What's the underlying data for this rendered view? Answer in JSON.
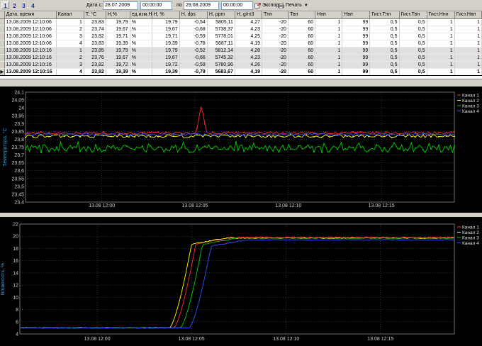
{
  "toolbar": {
    "pages": [
      "1",
      "2",
      "3",
      "4"
    ],
    "active_page": 0,
    "date_from_label": "Дата с:",
    "date_from": "28.07.2009",
    "time_from": "00:00:00",
    "date_to_label": "по",
    "date_to": "29.08.2009",
    "time_to": "00:00:00",
    "export_label": "Экспорт",
    "print_label": "Печать"
  },
  "table": {
    "columns": [
      "Дата, время",
      "Канал",
      "T, °C",
      "H,%",
      "ед.изм.H",
      "H, %",
      "H, dps",
      "H, ppm",
      "H, g/m3",
      "Тнп",
      "Твп",
      "Ннп",
      "Нвп",
      "Гист.Тнп",
      "Гист.Твп",
      "Гист.Ннп",
      "Гист.Нвп"
    ],
    "rows": [
      [
        "13.08.2009 12:10:06",
        "1",
        "23,83",
        "19,79",
        "%",
        "19,79",
        "-0,54",
        "5805,11",
        "4,27",
        "-20",
        "60",
        "1",
        "99",
        "0,5",
        "0,5",
        "1",
        "1"
      ],
      [
        "13.08.2009 12:10:06",
        "2",
        "23,74",
        "19,67",
        "%",
        "19,67",
        "-0,68",
        "5738,37",
        "4,23",
        "-20",
        "60",
        "1",
        "99",
        "0,5",
        "0,5",
        "1",
        "1"
      ],
      [
        "13.08.2009 12:10:06",
        "3",
        "23,82",
        "19,71",
        "%",
        "19,71",
        "-0,59",
        "5778,01",
        "4,25",
        "-20",
        "60",
        "1",
        "99",
        "0,5",
        "0,5",
        "1",
        "1"
      ],
      [
        "13.08.2009 12:10:06",
        "4",
        "23,83",
        "19,39",
        "%",
        "19,39",
        "-0,78",
        "5687,11",
        "4,19",
        "-20",
        "60",
        "1",
        "99",
        "0,5",
        "0,5",
        "1",
        "1"
      ],
      [
        "13.08.2009 12:10:16",
        "1",
        "23,85",
        "19,79",
        "%",
        "19,79",
        "-0,52",
        "5812,14",
        "4,28",
        "-20",
        "60",
        "1",
        "99",
        "0,5",
        "0,5",
        "1",
        "1"
      ],
      [
        "13.08.2009 12:10:16",
        "2",
        "23,76",
        "19,67",
        "%",
        "19,67",
        "-0,66",
        "5745,32",
        "4,23",
        "-20",
        "60",
        "1",
        "99",
        "0,5",
        "0,5",
        "1",
        "1"
      ],
      [
        "13.08.2009 12:10:16",
        "3",
        "23,82",
        "19,72",
        "%",
        "19,72",
        "-0,59",
        "5780,96",
        "4,26",
        "-20",
        "60",
        "1",
        "99",
        "0,5",
        "0,5",
        "1",
        "1"
      ],
      [
        "13.08.2009 12:10:16",
        "4",
        "23,82",
        "19,39",
        "%",
        "19,39",
        "-0,79",
        "5683,67",
        "4,19",
        "-20",
        "60",
        "1",
        "99",
        "0,5",
        "0,5",
        "1",
        "1"
      ]
    ]
  },
  "chart_data": [
    {
      "type": "line",
      "title": "",
      "ylabel": "Температура, °С",
      "xlabel": "",
      "ylim": [
        23.4,
        24.1
      ],
      "yticks": [
        "24,1",
        "24,05",
        "24",
        "23,95",
        "23,9",
        "23,85",
        "23,8",
        "23,75",
        "23,7",
        "23,65",
        "23,6",
        "23,55",
        "23,5",
        "23,45",
        "23,4"
      ],
      "x_ticks": [
        "13.08 12:00",
        "13.08 12:05",
        "13.08 12:10",
        "13.08 12:15"
      ],
      "x_range": [
        "13.08 11:56:00",
        "13.08 12:18:30"
      ],
      "grid": true,
      "legend_position": "top-right",
      "series": [
        {
          "name": "Канал 1",
          "color": "#ff3030",
          "base": 23.84,
          "noise": 0.008,
          "spike": {
            "at": 0.41,
            "value": 24.02
          }
        },
        {
          "name": "Канал 2",
          "color": "#ffff00",
          "base": 23.82,
          "noise": 0.01
        },
        {
          "name": "Канал 3",
          "color": "#00d000",
          "base": 23.74,
          "noise": 0.025
        },
        {
          "name": "Канал 4",
          "color": "#3050ff",
          "base": 23.83,
          "noise": 0.007
        }
      ]
    },
    {
      "type": "line",
      "title": "",
      "ylabel": "Влажность, %",
      "xlabel": "",
      "ylim": [
        4,
        22
      ],
      "yticks": [
        "22",
        "20",
        "18",
        "16",
        "14",
        "12",
        "10",
        "8",
        "6",
        "4"
      ],
      "x_ticks": [
        "13.08 12:00",
        "13.08 12:05",
        "13.08 12:10",
        "13.08 12:15"
      ],
      "x_range": [
        "13.08 11:56:00",
        "13.08 12:18:30"
      ],
      "grid": true,
      "legend_position": "top-right",
      "series": [
        {
          "name": "Канал 1",
          "color": "#ff3030",
          "low": 5.0,
          "high": 19.8,
          "rise_start": 0.355,
          "rise_end": 0.405
        },
        {
          "name": "Канал 2",
          "color": "#ffff00",
          "low": 5.0,
          "high": 19.7,
          "rise_start": 0.345,
          "rise_end": 0.395
        },
        {
          "name": "Канал 3",
          "color": "#00d000",
          "low": 5.0,
          "high": 19.7,
          "rise_start": 0.37,
          "rise_end": 0.42
        },
        {
          "name": "Канал 4",
          "color": "#3050ff",
          "low": 5.0,
          "high": 19.4,
          "rise_start": 0.39,
          "rise_end": 0.44
        }
      ]
    }
  ]
}
